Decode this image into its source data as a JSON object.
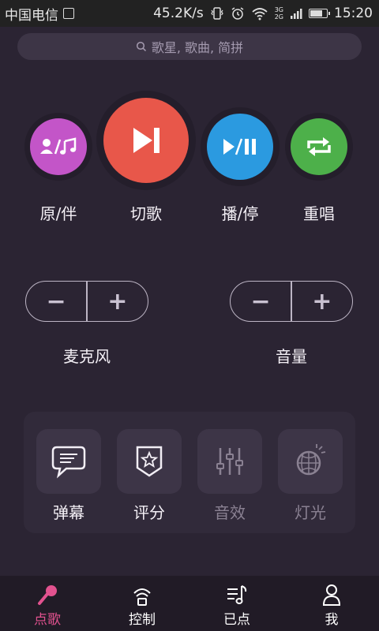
{
  "status": {
    "carrier": "中国电信",
    "speed": "45.2K/s",
    "time": "15:20",
    "net_3g": "3G",
    "net_2g": "2G"
  },
  "search": {
    "placeholder": "歌星, 歌曲, 简拼"
  },
  "playback": [
    {
      "label": "原/伴",
      "color": "#c355c8"
    },
    {
      "label": "切歌",
      "color": "#e8574a"
    },
    {
      "label": "播/停",
      "color": "#2b9ae0"
    },
    {
      "label": "重唱",
      "color": "#4db04a"
    }
  ],
  "mic": {
    "label": "麦克风",
    "minus": "−",
    "plus": "+"
  },
  "volume": {
    "label": "音量",
    "minus": "−",
    "plus": "+"
  },
  "tiles": [
    {
      "label": "弹幕",
      "enabled": true
    },
    {
      "label": "评分",
      "enabled": true
    },
    {
      "label": "音效",
      "enabled": false
    },
    {
      "label": "灯光",
      "enabled": false
    }
  ],
  "tabs": [
    {
      "label": "点歌",
      "active": true
    },
    {
      "label": "控制",
      "active": false
    },
    {
      "label": "已点",
      "active": false
    },
    {
      "label": "我",
      "active": false
    }
  ],
  "colors": {
    "accent": "#e2528f",
    "background": "#2b2433"
  }
}
